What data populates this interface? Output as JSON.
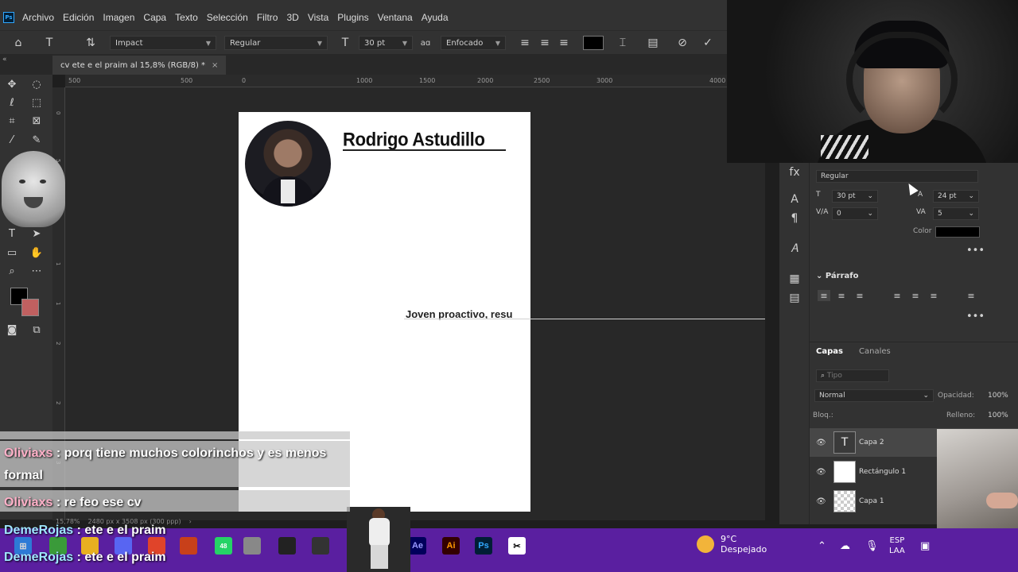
{
  "menubar": {
    "logo": "Ps",
    "items": [
      "Archivo",
      "Edición",
      "Imagen",
      "Capa",
      "Texto",
      "Selección",
      "Filtro",
      "3D",
      "Vista",
      "Plugins",
      "Ventana",
      "Ayuda"
    ]
  },
  "options": {
    "font_family": "Impact",
    "font_style": "Regular",
    "font_size": "30 pt",
    "aa_label": "aɑ",
    "anti_alias": "Enfocado"
  },
  "document_tab": {
    "title": "cv ete e el praim al 15,8% (RGB/8) *",
    "close": "×"
  },
  "ruler_h": [
    "500",
    "0",
    "500",
    "1000",
    "1500",
    "2000",
    "2500",
    "3000",
    "4000"
  ],
  "ruler_v": [
    "0",
    "5",
    "1",
    "1",
    "1",
    "2",
    "2",
    "3"
  ],
  "document": {
    "title": "Rodrigo Astudillo",
    "body_text": "Joven proactivo, resu"
  },
  "status": {
    "zoom": "15,78%",
    "info": "2480 px x 3508 px (300 ppp)",
    "arrow": "›"
  },
  "properties": {
    "font_style": "Regular",
    "size": "30 pt",
    "leading": "24 pt",
    "kerning": "0",
    "tracking": "5",
    "color_label": "Color",
    "color_value": "#000000",
    "paragraph_title": "Párrafo",
    "more": "•••"
  },
  "layers": {
    "tabs": [
      "Capas",
      "Canales"
    ],
    "search_placeholder": "Tipo",
    "blend_mode": "Normal",
    "opacity_label": "Opacidad:",
    "opacity_value": "100%",
    "lock_label": "Bloq.:",
    "fill_label": "Relleno:",
    "fill_value": "100%",
    "items": [
      {
        "name": "Capa 2",
        "type": "text"
      },
      {
        "name": "Rectángulo 1",
        "type": "shape"
      },
      {
        "name": "Capa 1",
        "type": "pixel"
      }
    ]
  },
  "chat": [
    {
      "user": "Oliviaxs",
      "text": " : porq tiene muchos colorinchos y es menos formal"
    },
    {
      "user": "Oliviaxs",
      "text": " : re feo ese cv"
    },
    {
      "user": "DemeRojas",
      "text": " : ete e el praim"
    },
    {
      "user": "DemeRojas",
      "text": " : ete e el praim"
    }
  ],
  "taskbar": {
    "apps": [
      "Ae",
      "Ai",
      "Ps"
    ],
    "whatsapp_badge": "48",
    "weather_temp": "9°C",
    "weather_desc": "Despejado",
    "lang_line1": "ESP",
    "lang_line2": "LAA"
  },
  "colors": {
    "accent_ps": "#31a8ff",
    "taskbar": "#5a1fa0",
    "foreground": "#000000",
    "background": "#c06060"
  }
}
